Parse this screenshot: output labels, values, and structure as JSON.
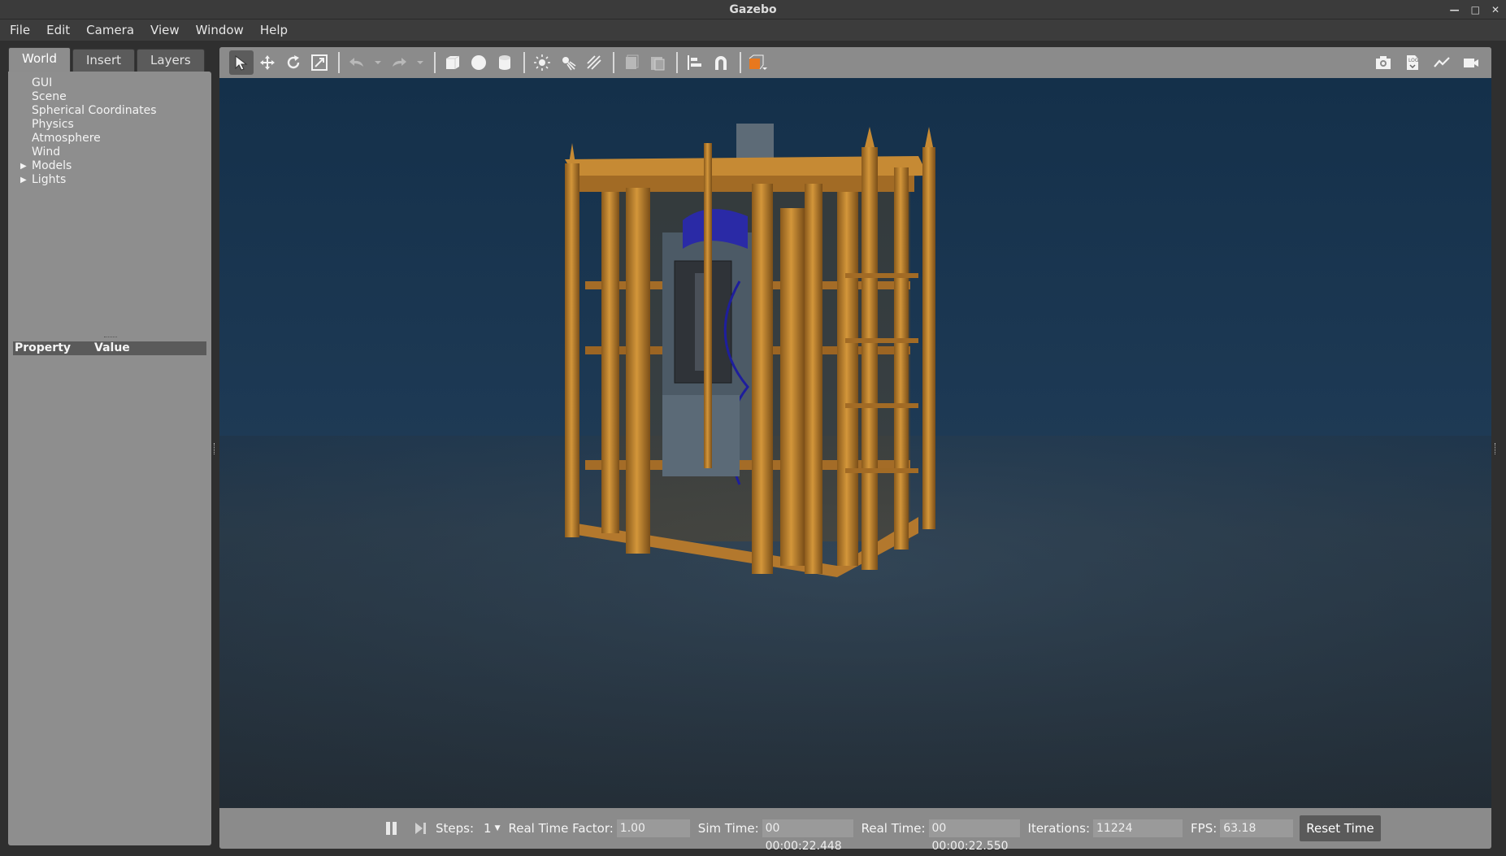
{
  "window": {
    "title": "Gazebo"
  },
  "menu": [
    "File",
    "Edit",
    "Camera",
    "View",
    "Window",
    "Help"
  ],
  "left_panel": {
    "tabs": [
      "World",
      "Insert",
      "Layers"
    ],
    "active_tab": "World",
    "tree": [
      {
        "label": "GUI",
        "expandable": false
      },
      {
        "label": "Scene",
        "expandable": false
      },
      {
        "label": "Spherical Coordinates",
        "expandable": false
      },
      {
        "label": "Physics",
        "expandable": false
      },
      {
        "label": "Atmosphere",
        "expandable": false
      },
      {
        "label": "Wind",
        "expandable": false
      },
      {
        "label": "Models",
        "expandable": true
      },
      {
        "label": "Lights",
        "expandable": true
      }
    ],
    "properties_header": {
      "property": "Property",
      "value": "Value"
    }
  },
  "toolbar": {
    "tools": [
      "select-icon",
      "translate-icon",
      "rotate-icon",
      "scale-icon",
      "undo-icon",
      "redo-icon",
      "box-icon",
      "sphere-icon",
      "cylinder-icon",
      "point-light-icon",
      "spot-light-icon",
      "directional-light-icon",
      "copy-icon",
      "paste-icon",
      "align-icon",
      "snap-icon",
      "view-angle-icon"
    ],
    "right_tools": [
      "screenshot-icon",
      "log-icon",
      "plot-icon",
      "video-icon"
    ]
  },
  "status": {
    "steps_label": "Steps:",
    "steps_value": "1",
    "rtf_label": "Real Time Factor:",
    "rtf_value": "1.00",
    "sim_time_label": "Sim Time:",
    "sim_time_value": "00 00:00:22.448",
    "real_time_label": "Real Time:",
    "real_time_value": "00 00:00:22.550",
    "iterations_label": "Iterations:",
    "iterations_value": "11224",
    "fps_label": "FPS:",
    "fps_value": "63.18",
    "reset_label": "Reset Time"
  },
  "colors": {
    "water_top": "#163048",
    "water_bottom": "#2a3c4d",
    "frame": "#c88a30",
    "panel_bg": "#8e8e8e"
  }
}
